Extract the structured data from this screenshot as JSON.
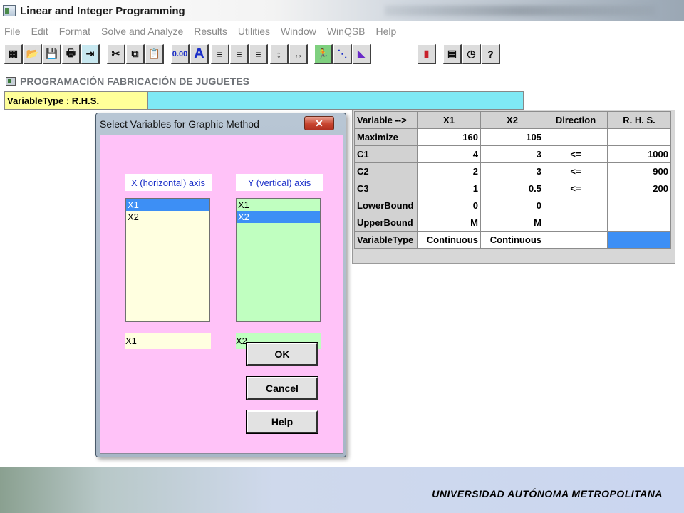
{
  "app": {
    "title": "Linear and Integer Programming"
  },
  "menu": [
    "File",
    "Edit",
    "Format",
    "Solve and Analyze",
    "Results",
    "Utilities",
    "Window",
    "WinQSB",
    "Help"
  ],
  "toolbar": {
    "buttons": [
      {
        "name": "new-problem-icon",
        "glyph": "▦"
      },
      {
        "name": "open-file-icon",
        "glyph": "📂"
      },
      {
        "name": "save-icon",
        "glyph": "💾"
      },
      {
        "name": "print-icon",
        "glyph": "🖶"
      },
      {
        "name": "exit-door-icon",
        "glyph": "⇥"
      },
      {
        "name": "cut-icon",
        "glyph": "✂"
      },
      {
        "name": "copy-icon",
        "glyph": "⧉"
      },
      {
        "name": "paste-icon",
        "glyph": "📋"
      },
      {
        "name": "number-format-icon",
        "glyph": "0.00"
      },
      {
        "name": "font-icon",
        "glyph": "A"
      },
      {
        "name": "align-left-icon",
        "glyph": "≡"
      },
      {
        "name": "align-center-icon",
        "glyph": "≡"
      },
      {
        "name": "align-right-icon",
        "glyph": "≡"
      },
      {
        "name": "row-height-icon",
        "glyph": "↕"
      },
      {
        "name": "column-width-icon",
        "glyph": "↔"
      },
      {
        "name": "solve-icon",
        "glyph": "🏃"
      },
      {
        "name": "solve-steps-icon",
        "glyph": "⋱"
      },
      {
        "name": "graphic-method-icon",
        "glyph": "◣"
      },
      {
        "name": "bar-chart-icon",
        "glyph": "▮"
      },
      {
        "name": "calculator-icon",
        "glyph": "▤"
      },
      {
        "name": "clock-icon",
        "glyph": "◷"
      },
      {
        "name": "help-icon",
        "glyph": "?"
      }
    ]
  },
  "document": {
    "title": "PROGRAMACIÓN FABRICACIÓN DE JUGUETES"
  },
  "entry": {
    "label": "VariableType : R.H.S.",
    "value": ""
  },
  "grid": {
    "header": [
      "Variable -->",
      "X1",
      "X2",
      "Direction",
      "R. H. S."
    ],
    "rows": [
      [
        "Maximize",
        "160",
        "105",
        "",
        ""
      ],
      [
        "C1",
        "4",
        "3",
        "<=",
        "1000"
      ],
      [
        "C2",
        "2",
        "3",
        "<=",
        "900"
      ],
      [
        "C3",
        "1",
        "0.5",
        "<=",
        "200"
      ],
      [
        "LowerBound",
        "0",
        "0",
        "",
        ""
      ],
      [
        "UpperBound",
        "M",
        "M",
        "",
        ""
      ],
      [
        "VariableType",
        "Continuous",
        "Continuous",
        "",
        ""
      ]
    ]
  },
  "dialog": {
    "title": "Select Variables for Graphic Method",
    "close_glyph": "✕",
    "x_axis_label": "X (horizontal) axis",
    "y_axis_label": "Y (vertical) axis",
    "x_options": [
      "X1",
      "X2"
    ],
    "y_options": [
      "X1",
      "X2"
    ],
    "x_selected": "X1",
    "y_selected": "X2",
    "ok_label": "OK",
    "cancel_label": "Cancel",
    "help_label": "Help"
  },
  "footer": {
    "text": "UNIVERSIDAD AUTÓNOMA METROPOLITANA"
  },
  "colors": {
    "dialog_client": "#ffc2f8",
    "x_list_bg": "#ffffe0",
    "y_list_bg": "#c0ffc0",
    "selection": "#3d8ff5",
    "entry_label_bg": "#ffff99",
    "entry_value_bg": "#7fe9f5",
    "axis_label_text": "#1a2ec8"
  }
}
